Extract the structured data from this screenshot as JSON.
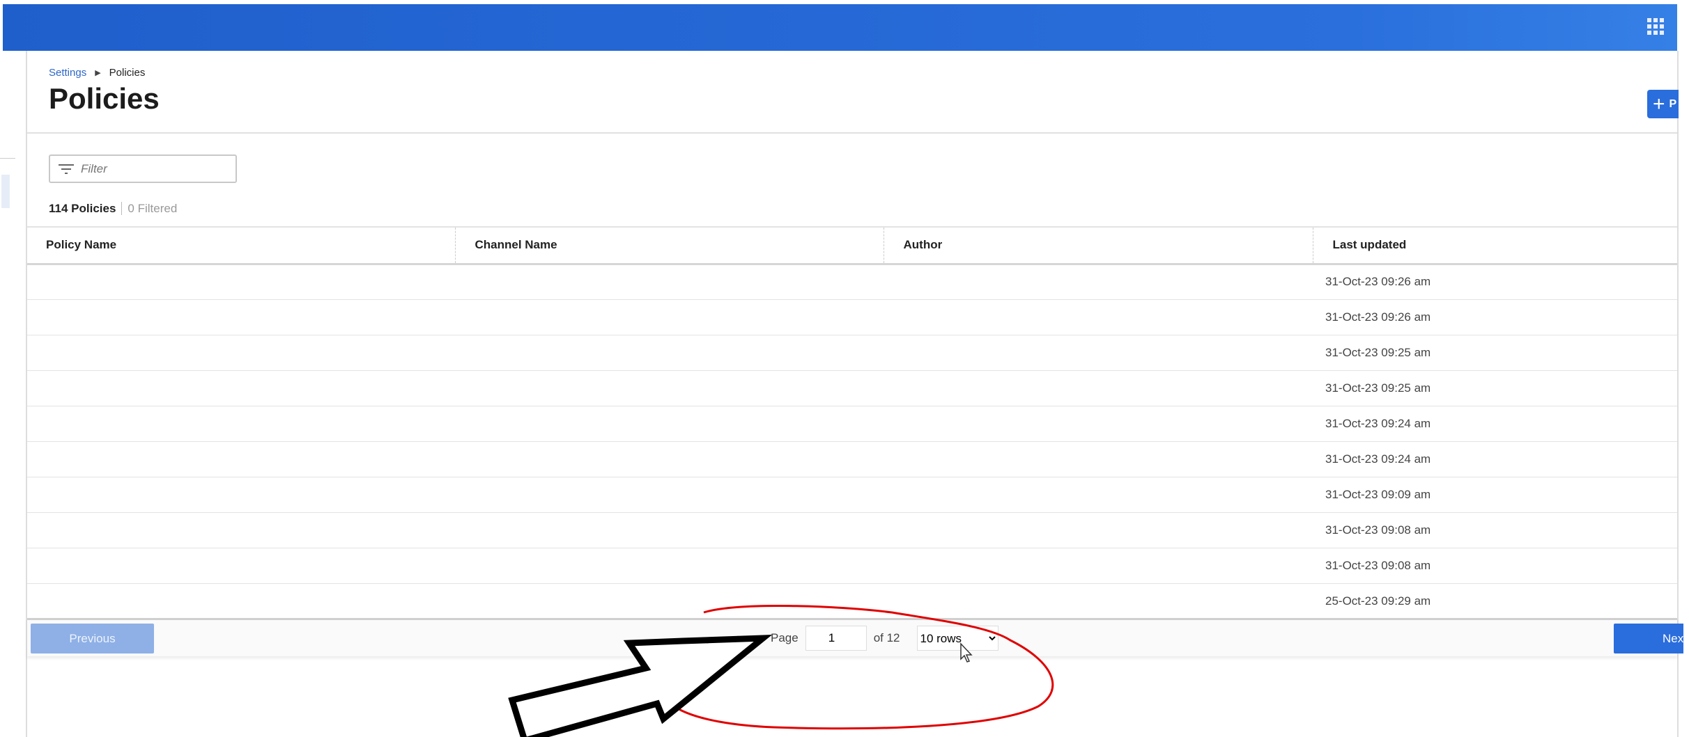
{
  "header": {
    "apps_icon": "grid-icon"
  },
  "breadcrumb": {
    "parent": "Settings",
    "current": "Policies"
  },
  "page": {
    "title": "Policies",
    "add_button_label": "P"
  },
  "filter": {
    "placeholder": "Filter",
    "value": ""
  },
  "summary": {
    "count": "114 Policies",
    "filtered": "0 Filtered"
  },
  "table": {
    "columns": [
      "Policy Name",
      "Channel Name",
      "Author",
      "Last updated"
    ],
    "rows": [
      {
        "last_updated": "31-Oct-23 09:26 am"
      },
      {
        "last_updated": "31-Oct-23 09:26 am"
      },
      {
        "last_updated": "31-Oct-23 09:25 am"
      },
      {
        "last_updated": "31-Oct-23 09:25 am"
      },
      {
        "last_updated": "31-Oct-23 09:24 am"
      },
      {
        "last_updated": "31-Oct-23 09:24 am"
      },
      {
        "last_updated": "31-Oct-23 09:09 am"
      },
      {
        "last_updated": "31-Oct-23 09:08 am"
      },
      {
        "last_updated": "31-Oct-23 09:08 am"
      },
      {
        "last_updated": "25-Oct-23 09:29 am"
      }
    ]
  },
  "pagination": {
    "previous": "Previous",
    "next": "Next",
    "page_label": "Page",
    "page_value": "1",
    "of_label": "of 12",
    "rows_option": "10 rows"
  },
  "colors": {
    "brand": "#2a6ddc",
    "annotation": "#e00000"
  }
}
